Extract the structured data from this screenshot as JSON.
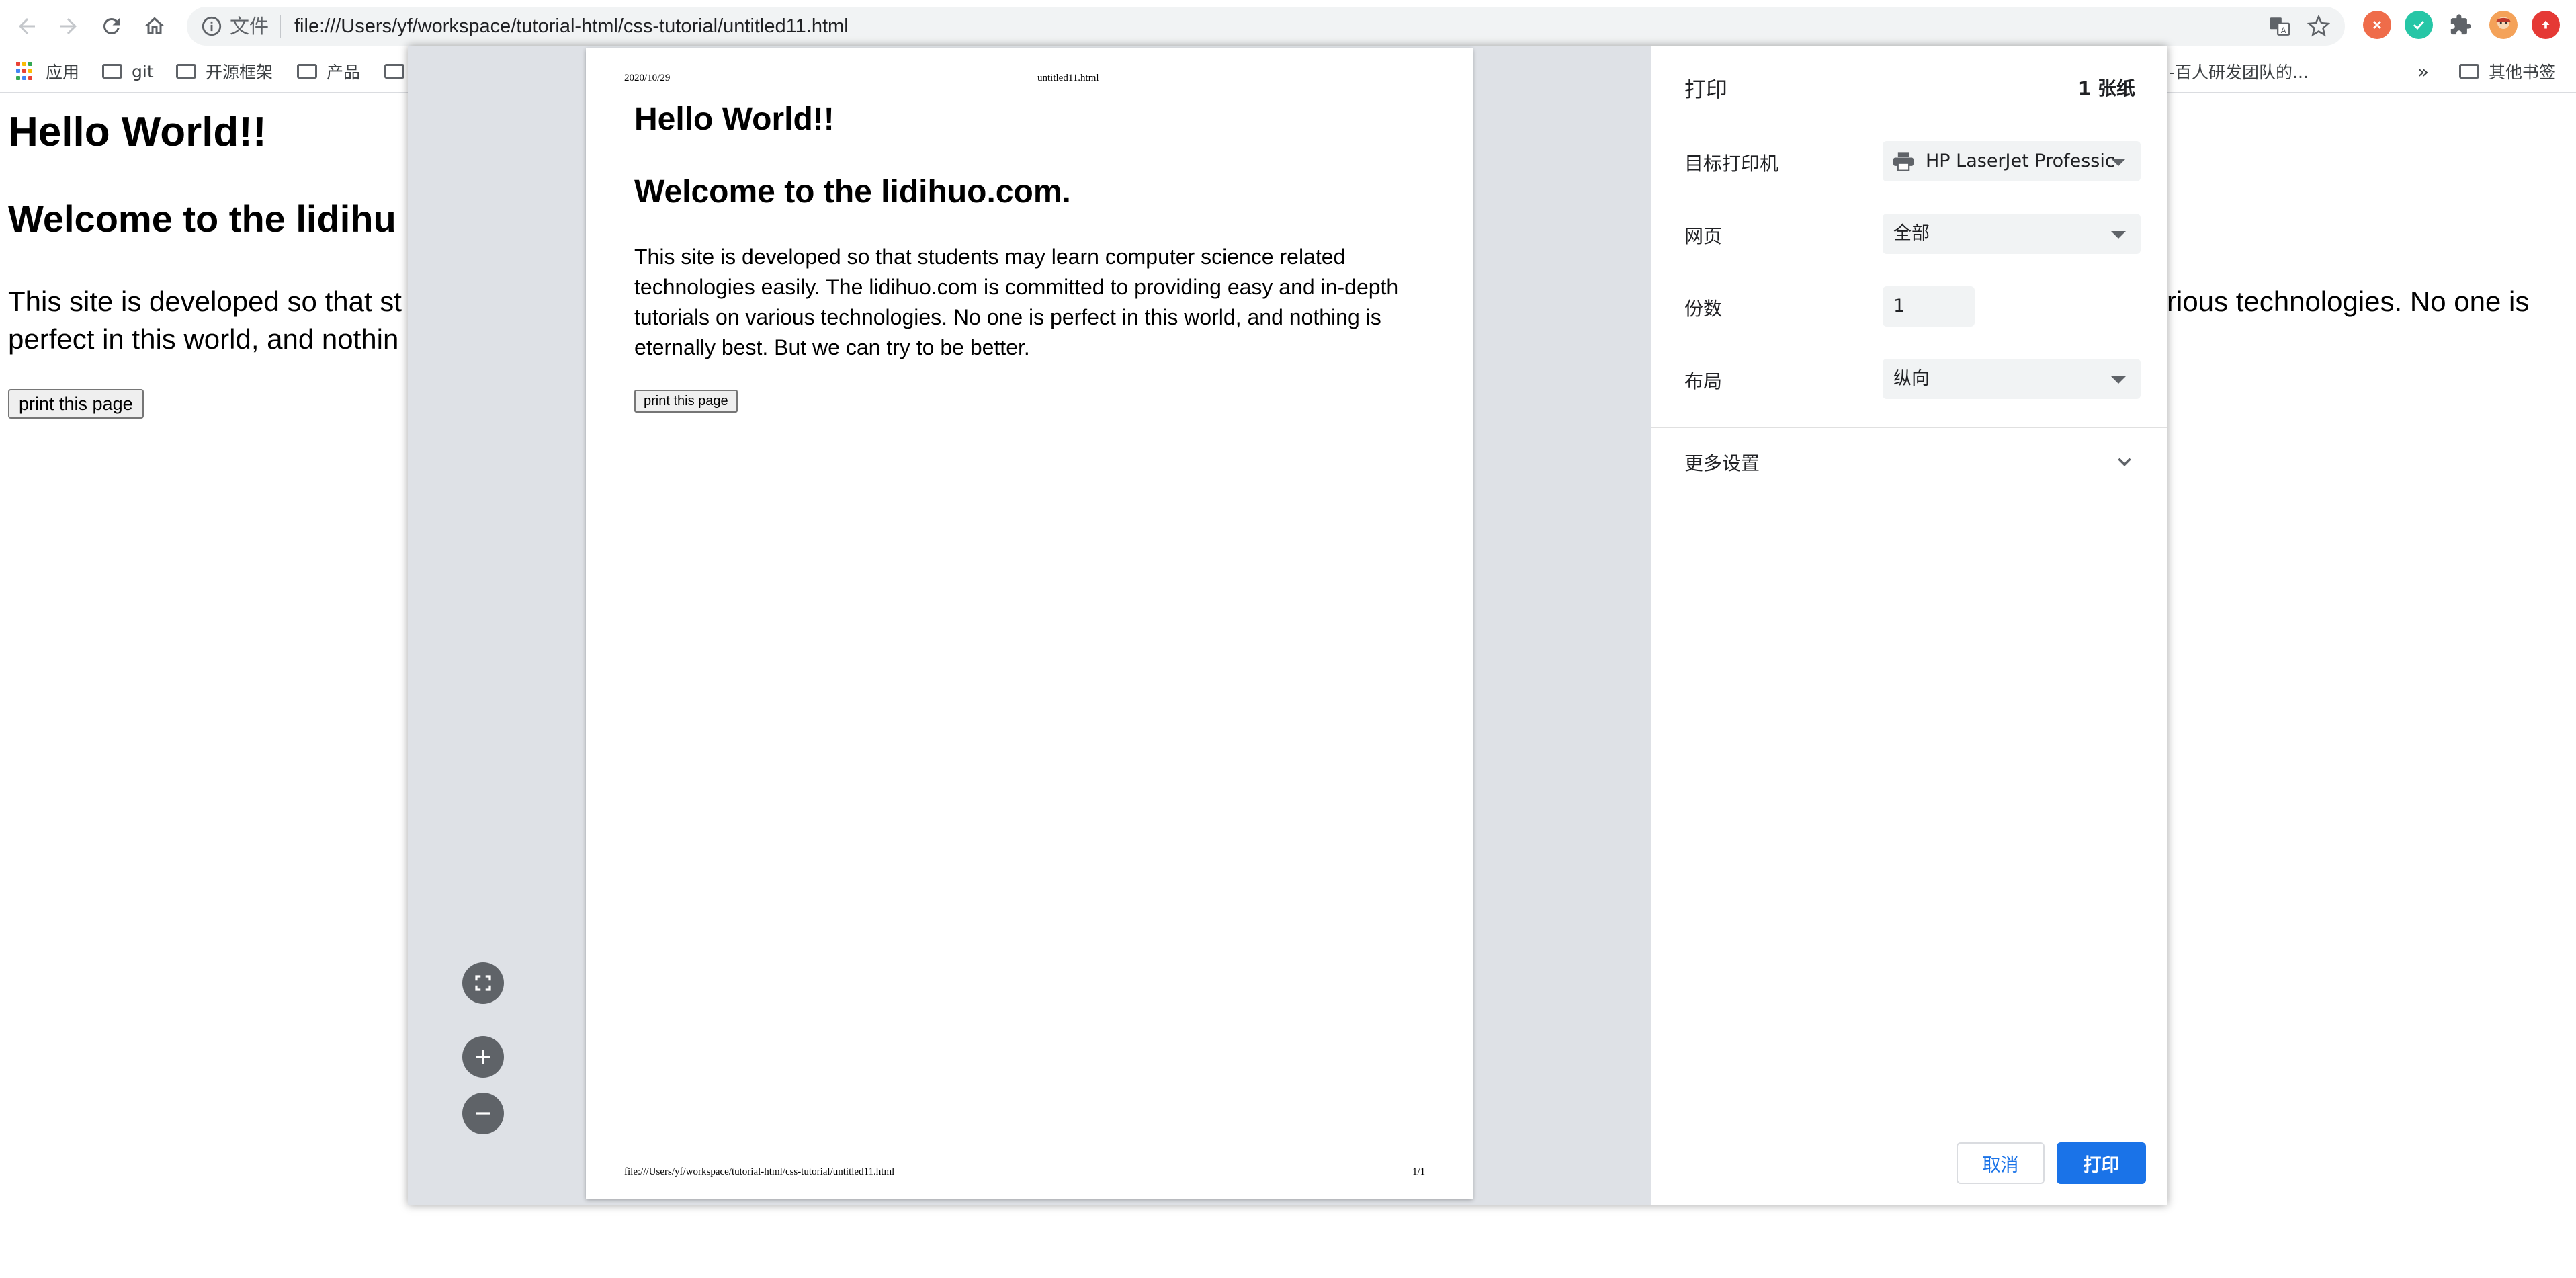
{
  "browser": {
    "scheme_label": "文件",
    "url": "file:///Users/yf/workspace/tutorial-html/css-tutorial/untitled11.html",
    "bookmarks": {
      "apps": "应用",
      "git": "git",
      "frameworks": "开源框架",
      "product": "产品",
      "truncated_item": "-百人研发团队的...",
      "overflow": "»",
      "other": "其他书签"
    }
  },
  "page": {
    "h1": "Hello World!!",
    "h2_visible": "Welcome to the lidihu",
    "paragraph_left": "This site is developed so that st perfect in this world, and nothin",
    "paragraph_right_line1": "rious technologies. No one is",
    "button": "print this page"
  },
  "print_preview": {
    "header_date": "2020/10/29",
    "header_title": "untitled11.html",
    "h1": "Hello World!!",
    "h2": "Welcome to the lidihuo.com.",
    "paragraph": "This site is developed so that students may learn computer science related technologies easily. The lidihuo.com is committed to providing easy and in-depth tutorials on various technologies. No one is perfect in this world, and nothing is eternally best. But we can try to be better.",
    "button": "print this page",
    "footer_url": "file:///Users/yf/workspace/tutorial-html/css-tutorial/untitled11.html",
    "footer_page": "1/1"
  },
  "print_settings": {
    "title": "打印",
    "sheets": "1 张纸",
    "destination_label": "目标打印机",
    "destination_value": "HP LaserJet Professic",
    "pages_label": "网页",
    "pages_value": "全部",
    "copies_label": "份数",
    "copies_value": "1",
    "layout_label": "布局",
    "layout_value": "纵向",
    "more_settings": "更多设置",
    "cancel": "取消",
    "print": "打印"
  },
  "colors": {
    "accent": "#1a73e8",
    "dialog_bg": "#dee1e6",
    "control_bg": "#f1f3f4"
  },
  "icons": [
    "back-arrow-icon",
    "forward-arrow-icon",
    "reload-icon",
    "home-icon",
    "info-icon",
    "translate-icon",
    "star-icon",
    "extension-icon",
    "fit-to-page-icon",
    "zoom-in-icon",
    "zoom-out-icon",
    "printer-icon",
    "chevron-down-icon"
  ]
}
